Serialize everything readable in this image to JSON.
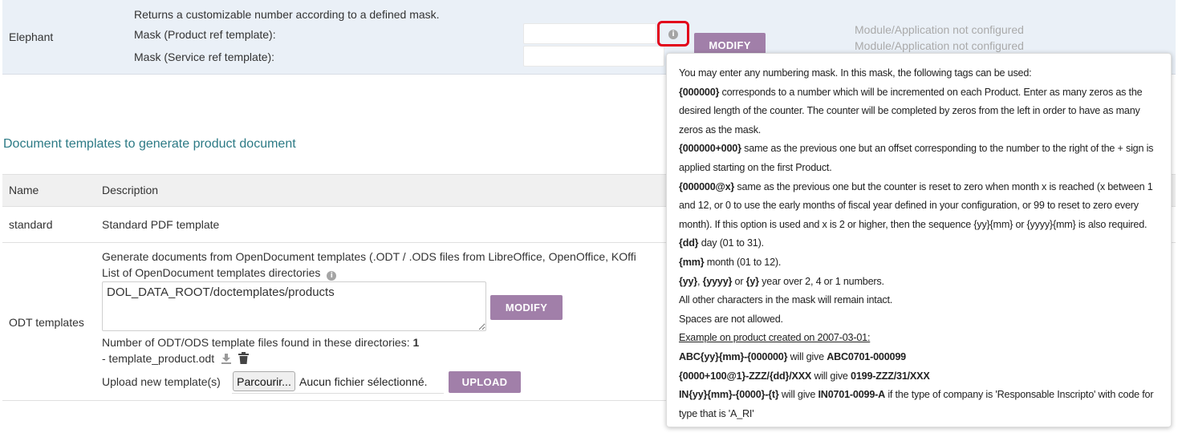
{
  "elephant": {
    "name": "Elephant",
    "description": "Returns a customizable number according to a defined mask.",
    "mask_product_label": "Mask (Product ref template):",
    "mask_service_label": "Mask (Service ref template):",
    "mask_product_value": "",
    "mask_service_value": "",
    "modify_label": "MODIFY",
    "status_1": "Module/Application not configured",
    "status_2": "Module/Application not configured"
  },
  "doc_section": {
    "title": "Document templates to generate product document",
    "columns": [
      "Name",
      "Description"
    ],
    "rows": {
      "standard": {
        "name": "standard",
        "description": "Standard PDF template"
      },
      "odt": {
        "name": "ODT templates",
        "generate_text": "Generate documents from OpenDocument templates (.ODT / .ODS files from LibreOffice, OpenOffice, KOffi",
        "dirs_label": "List of OpenDocument templates directories",
        "dirs_value": "DOL_DATA_ROOT/doctemplates/products",
        "modify_label": "MODIFY",
        "count_label": "Number of ODT/ODS template files found in these directories:",
        "count_value": "1",
        "file_name": "- template_product.odt",
        "upload_label": "Upload new template(s)",
        "browse_label": "Parcourir...",
        "no_file_label": "Aucun fichier sélectionné.",
        "upload_button": "UPLOAD"
      }
    }
  },
  "tooltip": {
    "intro": "You may enter any numbering mask. In this mask, the following tags can be used:",
    "tag1": "{000000}",
    "text1": " corresponds to a number which will be incremented on each Product. Enter as many zeros as the desired length of the counter. The counter will be completed by zeros from the left in order to have as many zeros as the mask.",
    "tag2": "{000000+000}",
    "text2": " same as the previous one but an offset corresponding to the number to the right of the + sign is applied starting on the first Product.",
    "tag3": "{000000@x}",
    "text3": " same as the previous one but the counter is reset to zero when month x is reached (x between 1 and 12, or 0 to use the early months of fiscal year defined in your configuration, or 99 to reset to zero every month). If this option is used and x is 2 or higher, then the sequence {yy}{mm} or {yyyy}{mm} is also required.",
    "tag4": "{dd}",
    "text4": " day (01 to 31).",
    "tag5": "{mm}",
    "text5": " month (01 to 12).",
    "tag6a": "{yy}",
    "sep6a": ", ",
    "tag6b": "{yyyy}",
    "sep6b": " or ",
    "tag6c": "{y}",
    "text6": " year over 2, 4 or 1 numbers.",
    "other": "All other characters in the mask will remain intact.",
    "spaces": "Spaces are not allowed.",
    "example_title": "Example on product created on 2007-03-01:",
    "ex1_mask": "ABC{yy}{mm}-{000000}",
    "ex1_mid": " will give ",
    "ex1_result": "ABC0701-000099",
    "ex2_mask": "{0000+100@1}-ZZZ/{dd}/XXX",
    "ex2_mid": " will give ",
    "ex2_result": "0199-ZZZ/31/XXX",
    "ex3_mask": "IN{yy}{mm}-{0000}-{t}",
    "ex3_mid": " will give ",
    "ex3_result": "IN0701-0099-A",
    "ex3_tail": " if the type of company is 'Responsable Inscripto' with code for type that is 'A_RI'"
  },
  "colors": {
    "accent": "#a17fa9",
    "title_teal": "#2c7a85",
    "header_bg": "#eaf0f7",
    "highlight_red": "#e2001a"
  }
}
